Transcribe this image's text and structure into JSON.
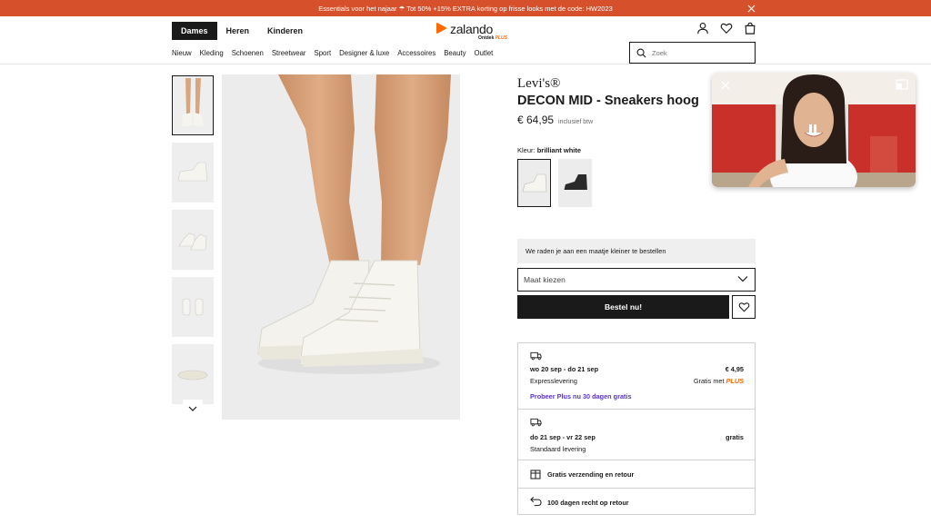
{
  "promo": {
    "text": "Essentials voor het najaar ☂ Tot 50% +15% EXTRA korting op frisse looks met de code: HW2023",
    "color": "#d6502b"
  },
  "header": {
    "gender_tabs": [
      "Dames",
      "Heren",
      "Kinderen"
    ],
    "active_gender": "Dames",
    "logo": {
      "word": "zalando",
      "sub": "Ontdek",
      "plus": "PLUS",
      "accent": "#ff6900"
    },
    "icons": [
      "user-icon",
      "heart-icon",
      "bag-icon"
    ]
  },
  "nav": {
    "items": [
      "Nieuw",
      "Kleding",
      "Schoenen",
      "Streetwear",
      "Sport",
      "Designer & luxe",
      "Accessoires",
      "Beauty",
      "Outlet"
    ]
  },
  "search": {
    "placeholder": "Zoek"
  },
  "gallery": {
    "thumb_count": 5,
    "active_thumb": 1
  },
  "product": {
    "brand": "Levi's®",
    "title": "DECON MID - Sneakers hoog",
    "price": "€ 64,95",
    "vat_note": "inclusief btw",
    "color_label": "Kleur:",
    "color_value": "brilliant white",
    "swatches": [
      "white",
      "black"
    ]
  },
  "size": {
    "advice": "We raden je aan een maatje kleiner te bestellen",
    "select_placeholder": "Maat kiezen"
  },
  "actions": {
    "order_label": "Bestel nu!"
  },
  "delivery": {
    "express": {
      "dates": "wo 20 sep - do 21 sep",
      "type": "Expresslevering",
      "price": "€ 4,95",
      "free_with": "Gratis met",
      "plus": "PLUS",
      "link": "Probeer Plus nu 30 dagen gratis"
    },
    "standard": {
      "dates": "do 21 sep - vr 22 sep",
      "type": "Standaard levering",
      "price": "gratis"
    },
    "free_shipping": "Gratis verzending en retour",
    "returns": "100 dagen recht op retour"
  }
}
